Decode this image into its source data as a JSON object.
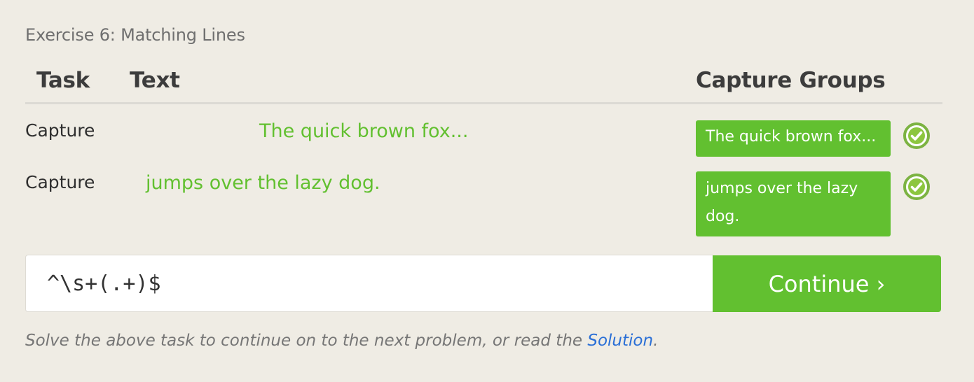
{
  "exercise": {
    "title": "Exercise 6: Matching Lines"
  },
  "table": {
    "headers": {
      "task": "Task",
      "text": "Text",
      "capture_groups": "Capture Groups"
    },
    "rows": [
      {
        "task": "Capture",
        "text": "The quick brown fox...",
        "group": "The quick brown fox...",
        "status": "matched",
        "status_icon": "check-circle-icon"
      },
      {
        "task": "Capture",
        "text": "jumps over the lazy dog.",
        "group": "jumps over the lazy dog.",
        "status": "matched",
        "status_icon": "check-circle-icon"
      }
    ]
  },
  "input": {
    "value": "^\\s+(.+)$",
    "placeholder": ""
  },
  "continue_button": {
    "label": "Continue ›"
  },
  "footer": {
    "text_before": "Solve the above task to continue on to the next problem, or read the ",
    "link": "Solution",
    "text_after": "."
  },
  "colors": {
    "background": "#efece4",
    "accent_green": "#62c030",
    "link_blue": "#2a6fd6",
    "check_green": "#7cb342"
  }
}
